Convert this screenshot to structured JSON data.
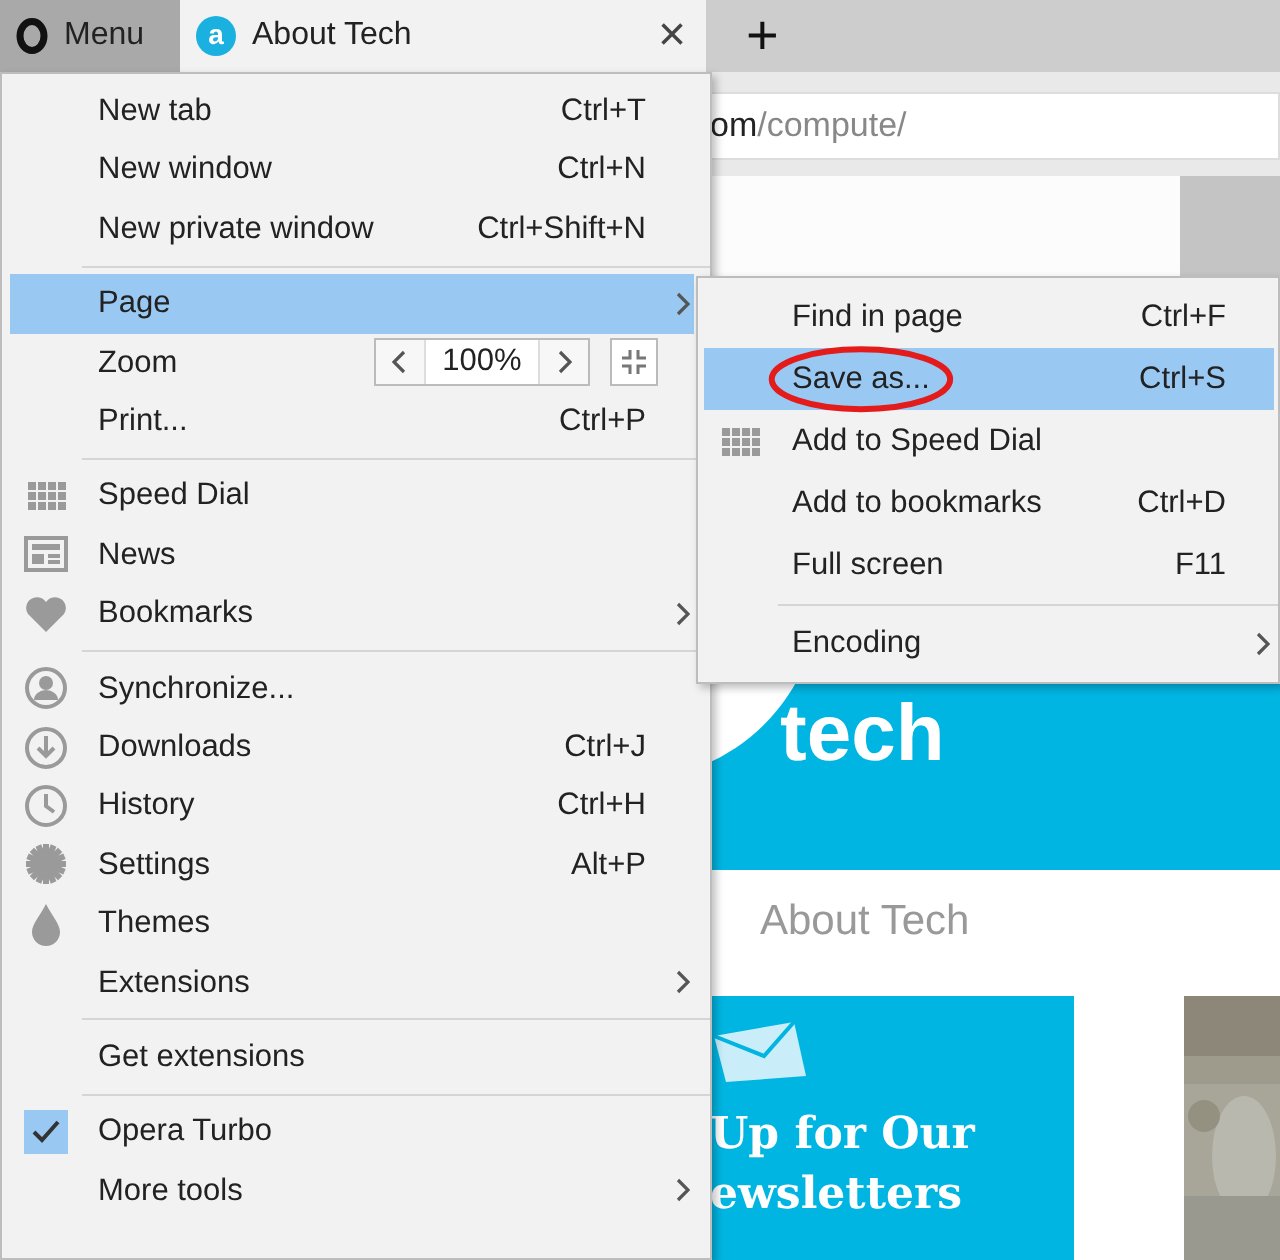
{
  "tab_bar": {
    "menu_button": "Menu",
    "tab": {
      "favicon_letter": "a",
      "title": "About Tech",
      "close": "×"
    },
    "new_tab": "+"
  },
  "address_bar": {
    "host_tail": "om",
    "path": "/compute/"
  },
  "page": {
    "banner_text": "tech",
    "heading": "About Tech",
    "newsletter": {
      "line_1": "Up for Our",
      "line_2": "ewsletters"
    }
  },
  "menu": {
    "items": [
      {
        "kind": "item",
        "label": "New tab",
        "shortcut": "Ctrl+T",
        "selected": false,
        "checked": false,
        "submenu": false
      },
      {
        "kind": "item",
        "label": "New window",
        "shortcut": "Ctrl+N",
        "selected": false,
        "checked": false,
        "submenu": false
      },
      {
        "kind": "item",
        "label": "New private window",
        "shortcut": "Ctrl+Shift+N",
        "selected": false,
        "checked": false,
        "submenu": false
      },
      {
        "kind": "separator"
      },
      {
        "kind": "item",
        "label": "Page",
        "selected": true,
        "checked": false,
        "submenu": true
      },
      {
        "kind": "zoom",
        "label": "Zoom",
        "value": "100%",
        "selected": false
      },
      {
        "kind": "item",
        "label": "Print...",
        "shortcut": "Ctrl+P",
        "selected": false,
        "checked": false,
        "submenu": false
      },
      {
        "kind": "separator"
      },
      {
        "kind": "item",
        "label": "Speed Dial",
        "selected": false,
        "checked": false,
        "submenu": false
      },
      {
        "kind": "item",
        "label": "News",
        "selected": false,
        "checked": false,
        "submenu": false
      },
      {
        "kind": "item",
        "label": "Bookmarks",
        "selected": false,
        "checked": false,
        "submenu": true
      },
      {
        "kind": "separator"
      },
      {
        "kind": "item",
        "label": "Synchronize...",
        "selected": false,
        "checked": false,
        "submenu": false
      },
      {
        "kind": "item",
        "label": "Downloads",
        "shortcut": "Ctrl+J",
        "selected": false,
        "checked": false,
        "submenu": false
      },
      {
        "kind": "item",
        "label": "History",
        "shortcut": "Ctrl+H",
        "selected": false,
        "checked": false,
        "submenu": false
      },
      {
        "kind": "item",
        "label": "Settings",
        "shortcut": "Alt+P",
        "selected": false,
        "checked": false,
        "submenu": false
      },
      {
        "kind": "item",
        "label": "Themes",
        "selected": false,
        "checked": false,
        "submenu": false
      },
      {
        "kind": "item",
        "label": "Extensions",
        "selected": false,
        "checked": false,
        "submenu": true
      },
      {
        "kind": "separator"
      },
      {
        "kind": "item",
        "label": "Get extensions",
        "selected": false,
        "checked": false,
        "submenu": false
      },
      {
        "kind": "separator"
      },
      {
        "kind": "item",
        "label": "Opera Turbo",
        "selected": false,
        "checked": true,
        "submenu": false
      },
      {
        "kind": "item",
        "label": "More tools",
        "selected": false,
        "checked": false,
        "submenu": true
      }
    ]
  },
  "submenu": {
    "items": [
      {
        "kind": "item",
        "label": "Find in page",
        "shortcut": "Ctrl+F",
        "selected": false,
        "circled": false,
        "submenu": false
      },
      {
        "kind": "item",
        "label": "Save as...",
        "shortcut": "Ctrl+S",
        "selected": true,
        "circled": true,
        "submenu": false
      },
      {
        "kind": "item",
        "label": "Add to Speed Dial",
        "selected": false,
        "circled": false,
        "submenu": false
      },
      {
        "kind": "item",
        "label": "Add to bookmarks",
        "shortcut": "Ctrl+D",
        "selected": false,
        "circled": false,
        "submenu": false
      },
      {
        "kind": "item",
        "label": "Full screen",
        "shortcut": "F11",
        "selected": false,
        "circled": false,
        "submenu": false
      },
      {
        "kind": "separator"
      },
      {
        "kind": "item",
        "label": "Encoding",
        "selected": false,
        "circled": false,
        "submenu": true
      }
    ]
  }
}
